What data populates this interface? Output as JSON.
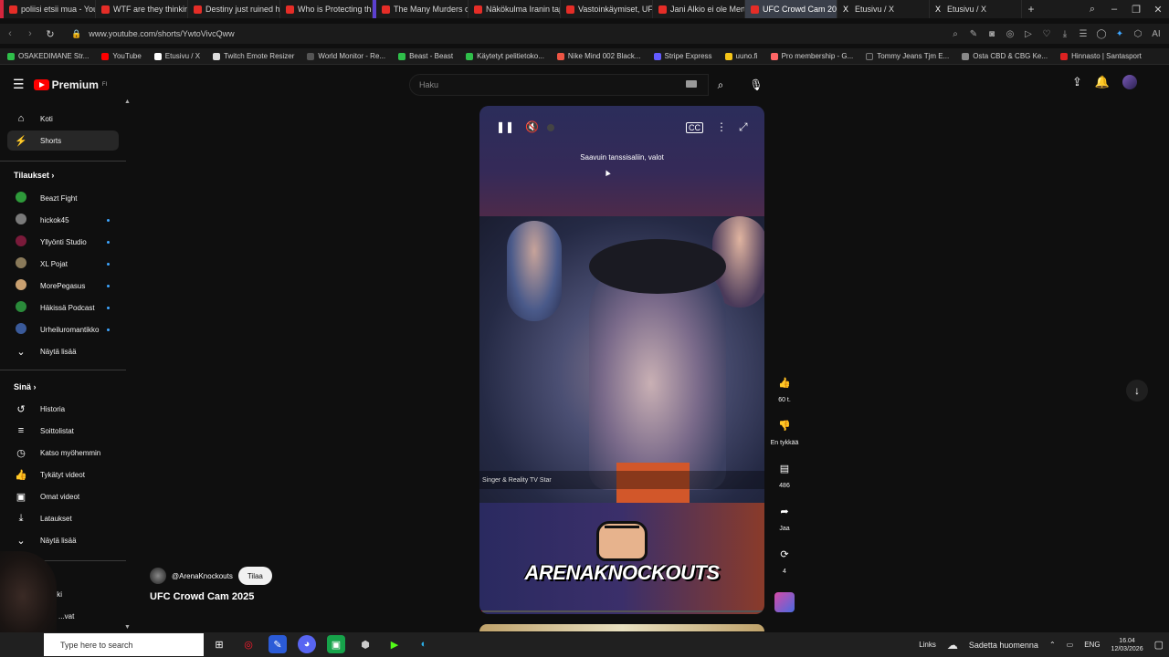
{
  "browser": {
    "tabs": [
      {
        "label": "poliisi etsii mua - You",
        "favicon": "youtube-icon"
      },
      {
        "label": "WTF are they thinking",
        "favicon": "youtube-icon"
      },
      {
        "label": "Destiny just ruined hi",
        "favicon": "youtube-icon"
      },
      {
        "label": "Who is Protecting the",
        "favicon": "youtube-icon"
      },
      {
        "label": "The Many Murders of",
        "favicon": "youtube-icon"
      },
      {
        "label": "Näkökulma Iranin tap",
        "favicon": "youtube-icon"
      },
      {
        "label": "Vastoinkäymiset, UFC",
        "favicon": "youtube-icon"
      },
      {
        "label": "Jani Alkio ei ole Mert",
        "favicon": "youtube-icon"
      },
      {
        "label": "UFC Crowd Cam 2025",
        "favicon": "youtube-icon",
        "active": true
      },
      {
        "label": "Etusivu / X",
        "favicon": "x-icon"
      },
      {
        "label": "Etusivu / X",
        "favicon": "x-icon"
      }
    ],
    "new_tab": "+",
    "url": "www.youtube.com/shorts/YwtoVivcQww",
    "bookmarks": [
      "OSAKEDIMANE Str...",
      "YouTube",
      "Etusivu / X",
      "Twitch Emote Resizer",
      "World Monitor - Re...",
      "Beast - Beast",
      "Käytetyt pelitietoko...",
      "Nike Mind 002 Black...",
      "Stripe Express",
      "uuno.fi",
      "Pro membership - G...",
      "Tommy Jeans Tjm E...",
      "Osta CBD & CBG Ke...",
      "Hinnasto | Santasport"
    ]
  },
  "youtube": {
    "logo_text": "Premium",
    "logo_sup": "FI",
    "search_placeholder": "Haku",
    "nav": [
      {
        "label": "Koti",
        "icon": "home-icon"
      },
      {
        "label": "Shorts",
        "icon": "shorts-icon",
        "active": true
      }
    ],
    "subscriptions_heading": "Tilaukset",
    "subscriptions": [
      {
        "label": "Beazt Fight",
        "color": "#2e9a3a"
      },
      {
        "label": "hickok45",
        "color": "#7a7a7a"
      },
      {
        "label": "Yllyönti Studio",
        "color": "#7a1a3a"
      },
      {
        "label": "XL Pojat",
        "color": "#8a7a5a"
      },
      {
        "label": "MorePegasus",
        "color": "#c9a070"
      },
      {
        "label": "Häkissä Podcast",
        "color": "#2a8a3a"
      },
      {
        "label": "Urheiluromantikko",
        "color": "#3a5a9a"
      }
    ],
    "show_more_1": "Näytä lisää",
    "you_heading": "Sinä",
    "you_items": [
      {
        "label": "Historia",
        "icon": "history-icon"
      },
      {
        "label": "Soittolistat",
        "icon": "playlist-icon"
      },
      {
        "label": "Katso myöhemmin",
        "icon": "clock-icon"
      },
      {
        "label": "Tykätyt videot",
        "icon": "like-icon"
      },
      {
        "label": "Omat videot",
        "icon": "video-icon"
      },
      {
        "label": "Lataukset",
        "icon": "download-icon"
      }
    ],
    "show_more_2": "Näytä lisää",
    "partial_items": [
      "...likki",
      "...vat"
    ],
    "short": {
      "subtitle": "Saavuin tanssisaliin, valot",
      "lower_caption": "Singer & Reality TV Star",
      "brand": "ARENAKNOCKOUTS",
      "channel": "@ArenaKnockouts",
      "subscribe_label": "Tilaa",
      "title": "UFC Crowd Cam 2025",
      "progress": 0.01
    },
    "actions": {
      "like_count": "60 t.",
      "dislike_label": "En tykkää",
      "comments_count": "486",
      "share_label": "Jaa",
      "remix_count": "4"
    }
  },
  "taskbar": {
    "search_placeholder": "Type here to search",
    "links_label": "Links",
    "weather": "Sadetta huomenna",
    "language": "ENG",
    "time": "16.04",
    "date": "12/03/2026"
  }
}
